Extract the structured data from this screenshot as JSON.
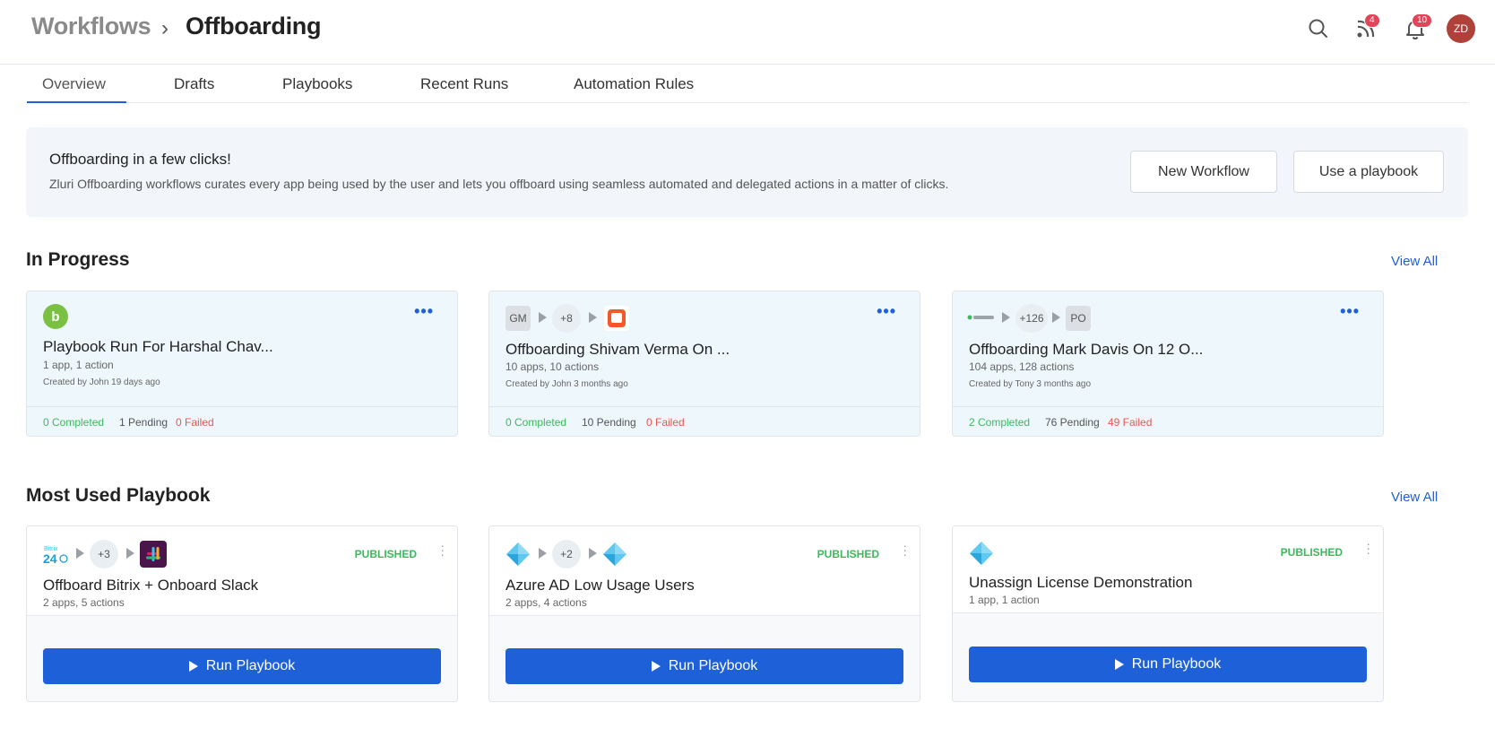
{
  "header": {
    "breadcrumb_root": "Workflows",
    "breadcrumb_sep": "›",
    "breadcrumb_current": "Offboarding",
    "feed_badge": "4",
    "notification_badge": "10",
    "avatar_initials": "ZD"
  },
  "tabs": [
    {
      "label": "Overview",
      "active": true
    },
    {
      "label": "Drafts",
      "active": false
    },
    {
      "label": "Playbooks",
      "active": false
    },
    {
      "label": "Recent Runs",
      "active": false
    },
    {
      "label": "Automation Rules",
      "active": false
    }
  ],
  "banner": {
    "title": "Offboarding in a few clicks!",
    "description": "Zluri Offboarding workflows curates every app being used by the user and lets you offboard using seamless automated and delegated actions in a matter of clicks.",
    "new_workflow_label": "New Workflow",
    "use_playbook_label": "Use a playbook"
  },
  "in_progress": {
    "title": "In Progress",
    "view_all": "View All",
    "cards": [
      {
        "title": "Playbook Run For Harshal Chav...",
        "subtitle": "1 app, 1 action",
        "meta": "Created by John 19 days ago",
        "completed": "0 Completed",
        "pending": "1 Pending",
        "failed": "0 Failed"
      },
      {
        "chip_initials": "GM",
        "chip_count": "+8",
        "title": "Offboarding Shivam Verma On ...",
        "subtitle": "10 apps, 10 actions",
        "meta": "Created by John 3 months ago",
        "completed": "0 Completed",
        "pending": "10 Pending",
        "failed": "0 Failed"
      },
      {
        "chip_count": "+126",
        "chip_initials": "PO",
        "title": "Offboarding Mark Davis On 12 O...",
        "subtitle": "104 apps, 128 actions",
        "meta": "Created by Tony 3 months ago",
        "completed": "2 Completed",
        "pending": "76 Pending",
        "failed": "49 Failed"
      }
    ]
  },
  "most_used": {
    "title": "Most Used Playbook",
    "view_all": "View All",
    "cards": [
      {
        "chip_count": "+3",
        "status": "PUBLISHED",
        "title": "Offboard Bitrix + Onboard Slack",
        "subtitle": "2 apps, 5 actions",
        "run_label": "Run Playbook"
      },
      {
        "chip_count": "+2",
        "status": "PUBLISHED",
        "title": "Azure AD Low Usage Users",
        "subtitle": "2 apps, 4 actions",
        "run_label": "Run Playbook"
      },
      {
        "status": "PUBLISHED",
        "title": "Unassign License Demonstration",
        "subtitle": "1 app, 1 action",
        "run_label": "Run Playbook"
      }
    ]
  },
  "colors": {
    "accent": "#1e60d8",
    "success": "#3bba5d",
    "danger": "#e8574f",
    "banner_bg": "#f2f5f9",
    "progress_card_bg": "#eef7fc"
  }
}
